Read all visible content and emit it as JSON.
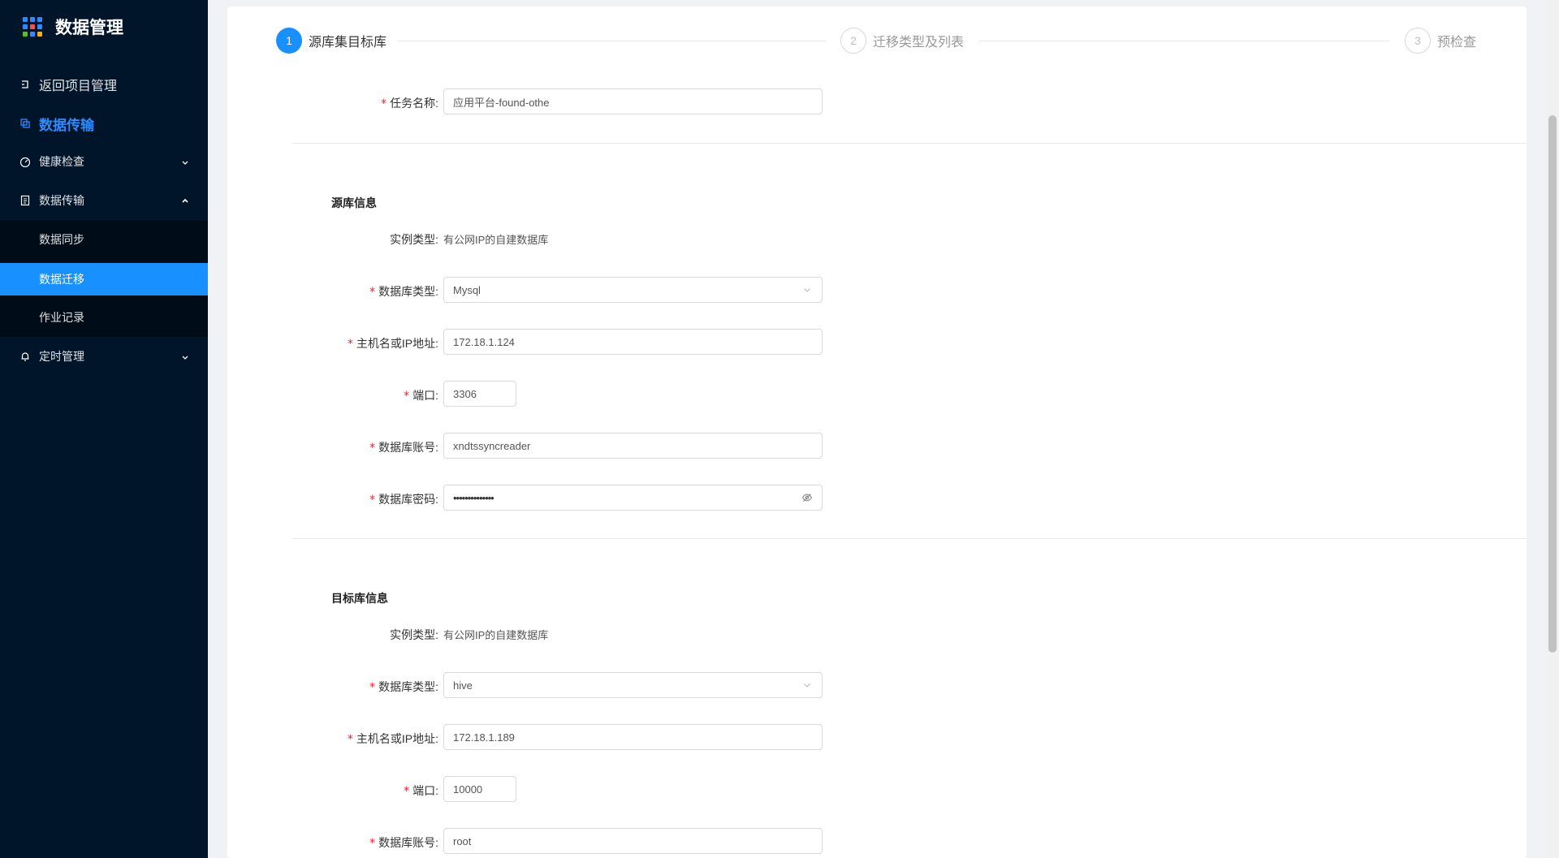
{
  "app": {
    "title": "数据管理",
    "brand_dot_colors": [
      "#2b8cff",
      "#2b8cff",
      "#2b8cff",
      "#2b8cff",
      "#ff4d4f",
      "#2b8cff",
      "#52c41a",
      "#2b8cff",
      "#faad14"
    ]
  },
  "sidebar": {
    "back_label": "返回项目管理",
    "current_label": "数据传输",
    "items": [
      {
        "label": "健康检查",
        "icon": "dashboard-icon",
        "expanded": false
      },
      {
        "label": "数据传输",
        "icon": "file-text-icon",
        "expanded": true
      },
      {
        "label": "定时管理",
        "icon": "bell-icon",
        "expanded": false
      }
    ],
    "sub_items": [
      {
        "label": "数据同步",
        "selected": false
      },
      {
        "label": "数据迁移",
        "selected": true
      },
      {
        "label": "作业记录",
        "selected": false
      }
    ]
  },
  "steps": [
    {
      "num": "1",
      "title": "源库集目标库",
      "status": "active"
    },
    {
      "num": "2",
      "title": "迁移类型及列表",
      "status": "wait"
    },
    {
      "num": "3",
      "title": "预检查",
      "status": "wait"
    }
  ],
  "form": {
    "task_name": {
      "label": "任务名称",
      "value": "应用平台-found-othe"
    },
    "source": {
      "title": "源库信息",
      "instance_type": {
        "label": "实例类型",
        "value": "有公网IP的自建数据库"
      },
      "db_type": {
        "label": "数据库类型",
        "value": "Mysql"
      },
      "host": {
        "label": "主机名或IP地址",
        "value": "172.18.1.124"
      },
      "port": {
        "label": "端口",
        "value": "3306"
      },
      "account": {
        "label": "数据库账号",
        "value": "xndtssyncreader"
      },
      "password": {
        "label": "数据库密码",
        "value": "••••••••••••••"
      }
    },
    "target": {
      "title": "目标库信息",
      "instance_type": {
        "label": "实例类型",
        "value": "有公网IP的自建数据库"
      },
      "db_type": {
        "label": "数据库类型",
        "value": "hive"
      },
      "host": {
        "label": "主机名或IP地址",
        "value": "172.18.1.189"
      },
      "port": {
        "label": "端口",
        "value": "10000"
      },
      "account": {
        "label": "数据库账号",
        "value": "root"
      }
    }
  }
}
